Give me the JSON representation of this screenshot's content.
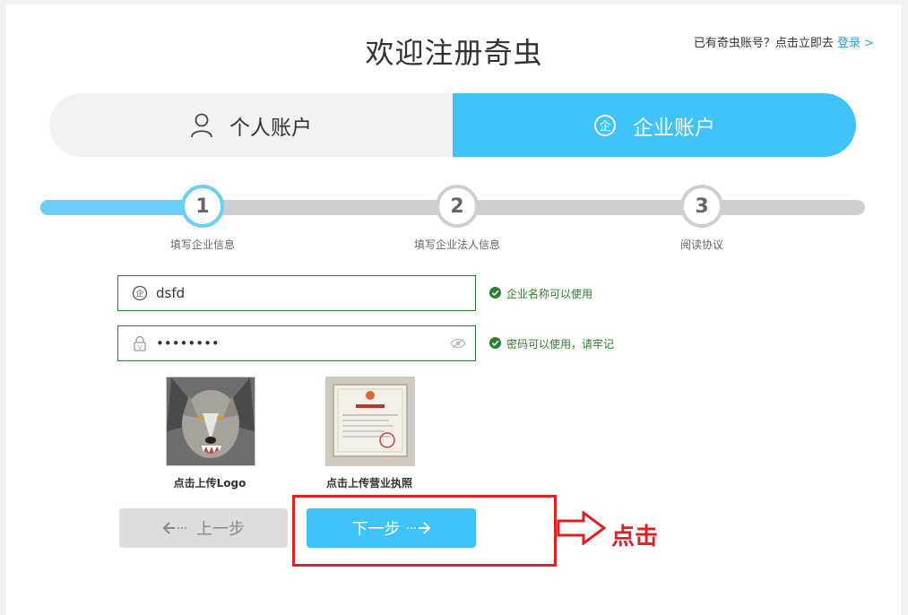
{
  "page": {
    "title": "欢迎注册奇虫",
    "login_hint": "已有奇虫账号？点击立即去",
    "login_link": "登录 >"
  },
  "tabs": [
    {
      "label": "个人账户",
      "icon": "person-icon",
      "active": false
    },
    {
      "label": "企业账户",
      "icon": "enterprise-icon",
      "active": true
    }
  ],
  "steps": [
    {
      "number": "1",
      "label": "填写企业信息",
      "active": true
    },
    {
      "number": "2",
      "label": "填写企业法人信息",
      "active": false
    },
    {
      "number": "3",
      "label": "阅读协议",
      "active": false
    }
  ],
  "form": {
    "company_name": {
      "value": "dsfd",
      "icon": "enterprise-icon",
      "hint": "企业名称可以使用"
    },
    "password": {
      "value": "••••••••",
      "icon": "lock-icon",
      "hint": "密码可以使用，请牢记"
    }
  },
  "uploads": [
    {
      "caption": "点击上传Logo",
      "image": "wolf-photo"
    },
    {
      "caption": "点击上传营业执照",
      "image": "business-license-photo"
    }
  ],
  "buttons": {
    "prev": "上一步",
    "next": "下一步"
  },
  "annotation": {
    "text": "点击",
    "color": "#e02020"
  },
  "colors": {
    "accent": "#3ec2f7",
    "success": "#2e7d32"
  }
}
